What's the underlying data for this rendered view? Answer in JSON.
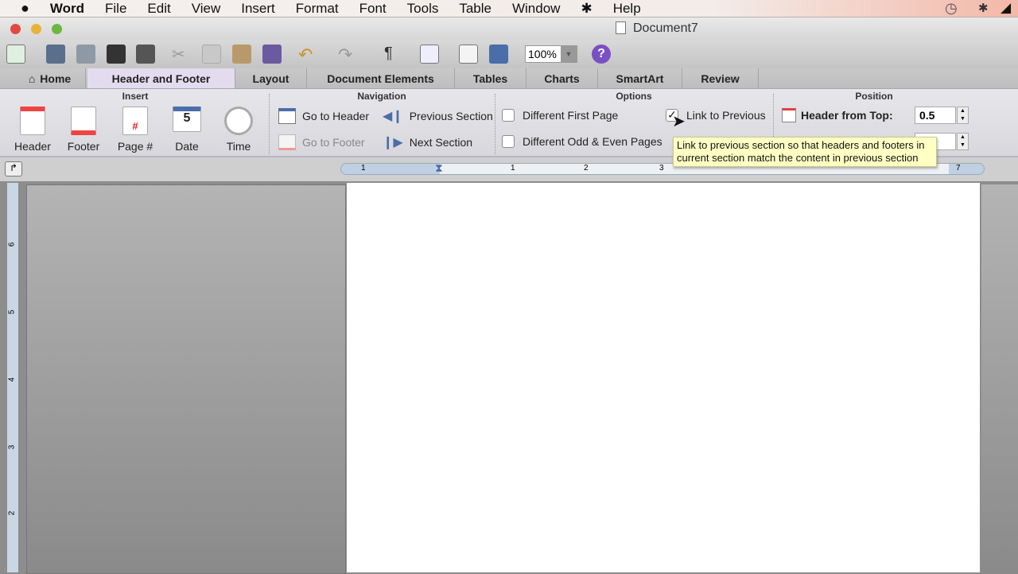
{
  "menubar": {
    "items": [
      "Word",
      "File",
      "Edit",
      "View",
      "Insert",
      "Format",
      "Font",
      "Tools",
      "Table",
      "Window",
      "Help"
    ],
    "icons": [
      "apple-icon",
      "script-icon",
      "time-machine-icon",
      "bluetooth-icon",
      "wifi-icon"
    ]
  },
  "window": {
    "title": "Document7"
  },
  "toolbar": {
    "zoom": "100%"
  },
  "tabs": [
    "Home",
    "Header and Footer",
    "Layout",
    "Document Elements",
    "Tables",
    "Charts",
    "SmartArt",
    "Review"
  ],
  "active_tab": "Header and Footer",
  "ribbon": {
    "insert": {
      "title": "Insert",
      "items": [
        "Header",
        "Footer",
        "Page #",
        "Date",
        "Time"
      ],
      "date_day": "5"
    },
    "navigation": {
      "title": "Navigation",
      "go_header": "Go to Header",
      "go_footer": "Go to Footer",
      "prev": "Previous Section",
      "next": "Next Section"
    },
    "options": {
      "title": "Options",
      "first": "Different First Page",
      "odd_even": "Different Odd & Even Pages",
      "link": "Link to Previous",
      "link_checked": true
    },
    "position": {
      "title": "Position",
      "header_from_top_label": "Header from Top:",
      "header_from_top": "0.5"
    }
  },
  "tooltip": "Link to  previous section so that headers and footers in current section match the content in previous section",
  "ruler": {
    "h": [
      "1",
      "1",
      "2",
      "3",
      "7"
    ],
    "v": [
      "6",
      "5",
      "4",
      "3",
      "2"
    ]
  }
}
